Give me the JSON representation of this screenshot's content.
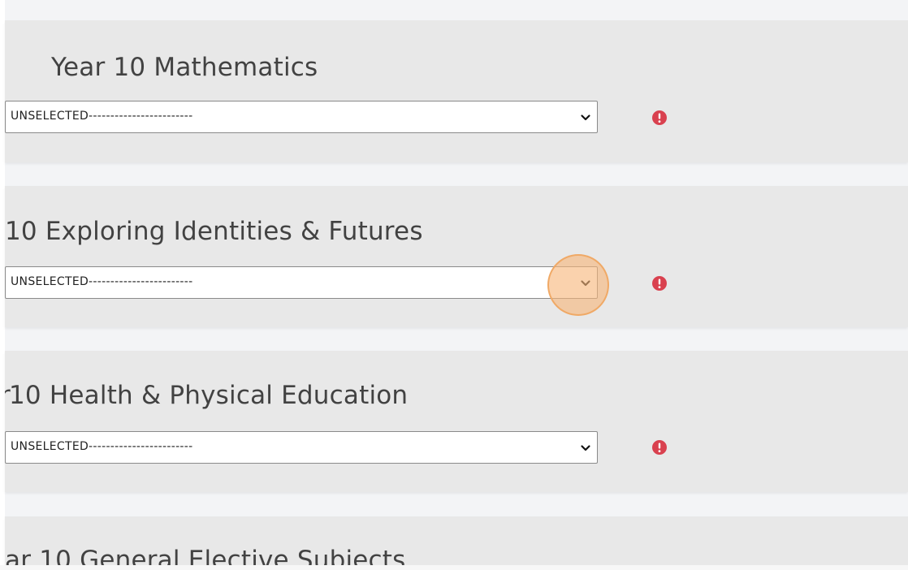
{
  "sections": [
    {
      "title": "Year 10 Mathematics",
      "select": {
        "selected": "UNSELECTED------------------------"
      },
      "status_icon": "alert-circle-icon"
    },
    {
      "title": "10 Exploring Identities & Futures",
      "select": {
        "selected": "UNSELECTED------------------------"
      },
      "status_icon": "alert-circle-icon"
    },
    {
      "title": "10 Health & Physical Education",
      "title_fragment": "r",
      "select": {
        "selected": "UNSELECTED------------------------"
      },
      "status_icon": "alert-circle-icon"
    },
    {
      "title": "ar 10 General Elective Subjects"
    }
  ],
  "colors": {
    "card_bg": "#e8e8e8",
    "page_bg": "#f3f4f6",
    "alert": "#d9414f",
    "click_marker": "#f7b77b"
  }
}
